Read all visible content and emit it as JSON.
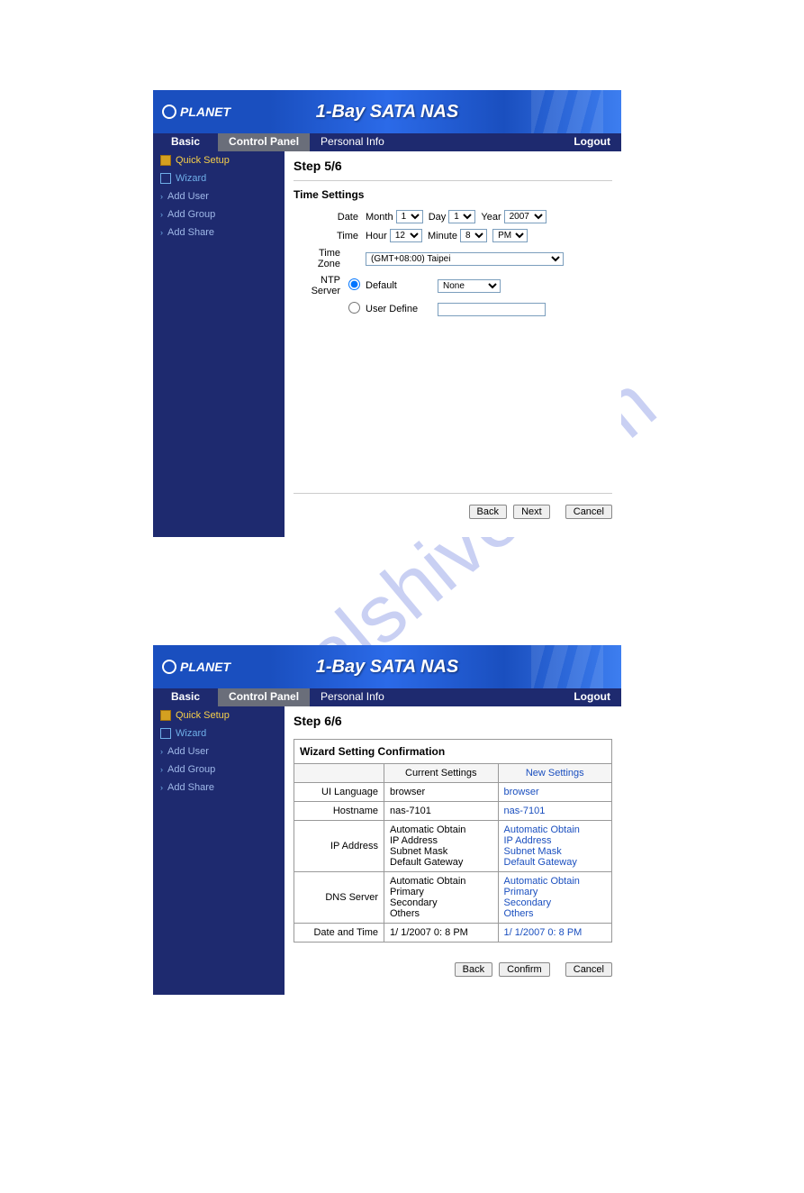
{
  "brand": "PLANET",
  "title": "1-Bay SATA NAS",
  "menu": {
    "basic": "Basic",
    "control": "Control Panel",
    "personal": "Personal Info",
    "logout": "Logout"
  },
  "sidebar": {
    "quick": "Quick Setup",
    "wizard": "Wizard",
    "adduser": "Add User",
    "addgroup": "Add Group",
    "addshare": "Add Share"
  },
  "step5": {
    "step": "Step 5/6",
    "section": "Time Settings",
    "date_label": "Date",
    "month_label": "Month",
    "month_val": "1",
    "day_label": "Day",
    "day_val": "1",
    "year_label": "Year",
    "year_val": "2007",
    "time_label": "Time",
    "hour_label": "Hour",
    "hour_val": "12",
    "minute_label": "Minute",
    "minute_val": "8",
    "ampm_val": "PM",
    "tz_label": "Time Zone",
    "tz_val": "(GMT+08:00) Taipei",
    "ntp_label": "NTP Server",
    "default_label": "Default",
    "default_val": "None",
    "userdef_label": "User Define",
    "back": "Back",
    "next": "Next",
    "cancel": "Cancel"
  },
  "step6": {
    "step": "Step 6/6",
    "caption": "Wizard Setting Confirmation",
    "th_current": "Current Settings",
    "th_new": "New Settings",
    "ui_lang_label": "UI Language",
    "ui_lang_cur": "browser",
    "ui_lang_new": "browser",
    "host_label": "Hostname",
    "host_cur": "nas-7101",
    "host_new": "nas-7101",
    "ip_label": "IP Address",
    "ip_cur": "Automatic Obtain\nIP Address\nSubnet Mask\nDefault Gateway",
    "ip_new": "Automatic Obtain\nIP Address\nSubnet Mask\nDefault Gateway",
    "dns_label": "DNS Server",
    "dns_cur": "Automatic Obtain\nPrimary\nSecondary\nOthers",
    "dns_new": "Automatic Obtain\nPrimary\nSecondary\nOthers",
    "dt_label": "Date and Time",
    "dt_cur": "1/ 1/2007 0: 8 PM",
    "dt_new": "1/ 1/2007 0: 8 PM",
    "back": "Back",
    "confirm": "Confirm",
    "cancel": "Cancel"
  }
}
